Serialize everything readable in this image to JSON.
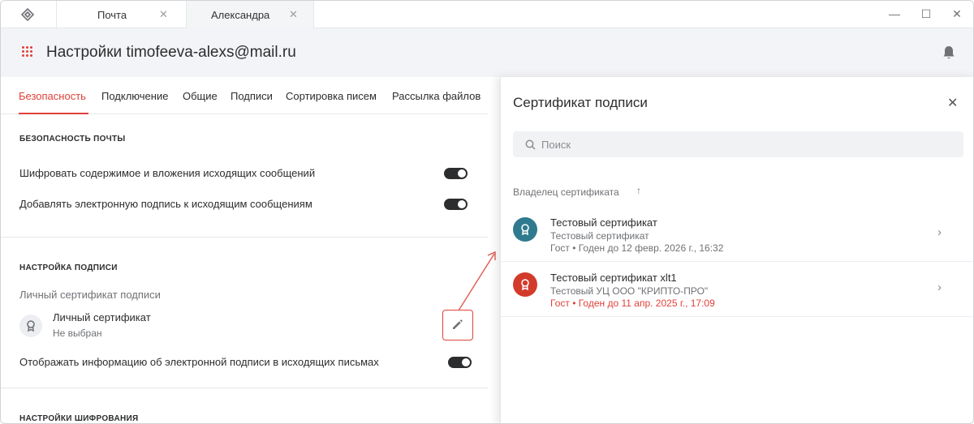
{
  "window": {
    "tabs": [
      {
        "label": "Почта",
        "close": "✕"
      },
      {
        "label": "Александра",
        "close": "✕"
      }
    ],
    "controls": {
      "minimize": "—",
      "maximize": "☐",
      "close": "✕"
    }
  },
  "header": {
    "title": "Настройки timofeeva-alexs@mail.ru"
  },
  "settings": {
    "tabs": [
      {
        "label": "Безопасность",
        "active": true
      },
      {
        "label": "Подключение"
      },
      {
        "label": "Общие"
      },
      {
        "label": "Подписи"
      },
      {
        "label": "Сортировка писем"
      },
      {
        "label": "Рассылка файлов"
      }
    ],
    "mail_security": {
      "title": "БЕЗОПАСНОСТЬ ПОЧТЫ",
      "encrypt_label": "Шифровать содержимое и вложения исходящих сообщений",
      "encrypt_on": true,
      "sign_label": "Добавлять электронную подпись к исходящим сообщениям",
      "sign_on": true
    },
    "signature": {
      "title": "НАСТРОЙКА ПОДПИСИ",
      "personal_cert_label": "Личный сертификат подписи",
      "cert_name": "Личный сертификат",
      "cert_status": "Не выбран",
      "show_info_label": "Отображать информацию об электронной подписи в исходящих письмах",
      "show_info_on": true
    },
    "encryption": {
      "title": "НАСТРОЙКИ ШИФРОВАНИЯ"
    }
  },
  "panel": {
    "title": "Сертификат подписи",
    "close": "✕",
    "search_placeholder": "Поиск",
    "column_header": "Владелец сертификата",
    "sort_arrow": "↑",
    "certificates": [
      {
        "title": "Тестовый сертификат",
        "issuer": "Тестовый сертификат",
        "validity": "Гост • Годен до 12 февр. 2026 г., 16:32",
        "color": "#2f7a8f",
        "expired": false,
        "chevron": "›"
      },
      {
        "title": "Тестовый сертификат xlt1",
        "issuer": "Тестовый УЦ ООО \"КРИПТО-ПРО\"",
        "validity": "Гост • Годен до 11 апр. 2025 г., 17:09",
        "color": "#d23b2b",
        "expired": true,
        "chevron": "›"
      }
    ]
  },
  "colors": {
    "accent": "#e0413a",
    "toggle_on": "#2c2d2e"
  }
}
